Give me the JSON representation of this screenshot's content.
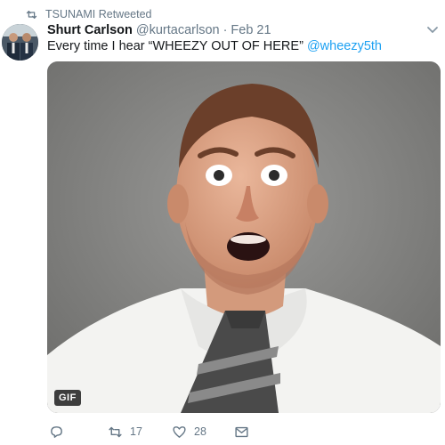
{
  "retweet_banner": {
    "text": "TSUNAMI Retweeted",
    "icon": "retweet-icon"
  },
  "tweet": {
    "author_name": "Shurt Carlson",
    "author_handle": "@kurtacarlson",
    "separator": "·",
    "timestamp": "Feb 21",
    "text_main": "Every time I hear “WHEEZY OUT OF HERE”",
    "text_mention": "@wheezy5th",
    "media_badge": "GIF"
  },
  "actions": {
    "reply": {
      "icon": "reply-icon",
      "count": ""
    },
    "retweet": {
      "icon": "retweet-icon",
      "count": "17"
    },
    "like": {
      "icon": "heart-icon",
      "count": "28"
    },
    "message": {
      "icon": "envelope-icon",
      "count": ""
    }
  },
  "colors": {
    "accent": "#1da1f2",
    "muted": "#657786",
    "text": "#14171a"
  }
}
